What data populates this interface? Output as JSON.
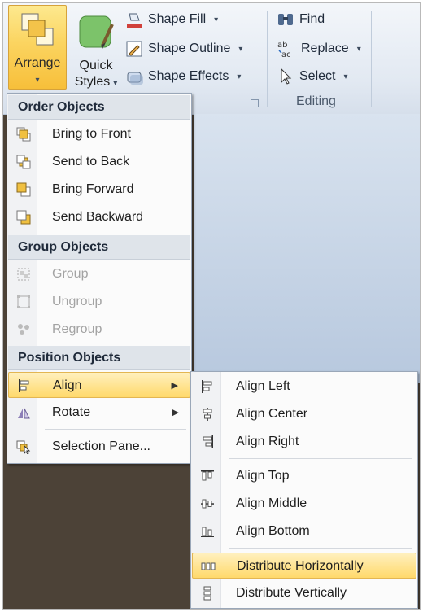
{
  "ribbon": {
    "arrange_label": "Arrange",
    "quick_styles_line1": "Quick",
    "quick_styles_line2": "Styles",
    "shape_fill": "Shape Fill",
    "shape_outline": "Shape Outline",
    "shape_effects": "Shape Effects",
    "find": "Find",
    "replace": "Replace",
    "select": "Select",
    "editing_group": "Editing",
    "caret": "▾"
  },
  "arrange_menu": {
    "order_header": "Order Objects",
    "bring_to_front": "Bring to Front",
    "send_to_back": "Send to Back",
    "bring_forward": "Bring Forward",
    "send_backward": "Send Backward",
    "group_header": "Group Objects",
    "group": "Group",
    "ungroup": "Ungroup",
    "regroup": "Regroup",
    "position_header": "Position Objects",
    "align": "Align",
    "rotate": "Rotate",
    "selection_pane": "Selection Pane...",
    "submenu_arrow": "▶"
  },
  "align_menu": {
    "align_left": "Align Left",
    "align_center": "Align Center",
    "align_right": "Align Right",
    "align_top": "Align Top",
    "align_middle": "Align Middle",
    "align_bottom": "Align Bottom",
    "distribute_horizontally": "Distribute Horizontally",
    "distribute_vertically": "Distribute Vertically"
  },
  "colors": {
    "highlight": "#ffd96b",
    "ribbon": "#e2e9f2",
    "background": "#4c4237"
  }
}
